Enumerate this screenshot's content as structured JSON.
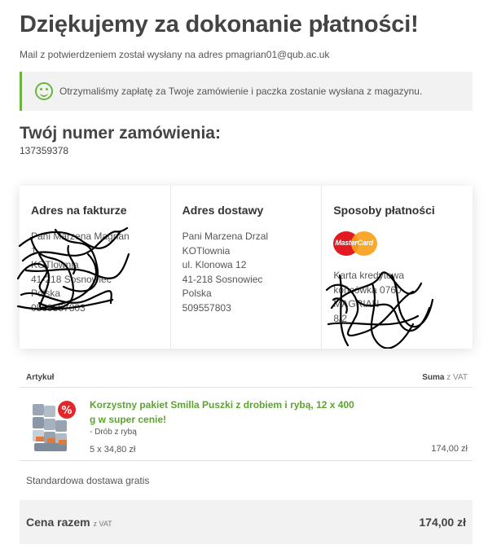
{
  "header": {
    "title": "Dziękujemy za dokonanie płatności!",
    "subtitle": "Mail z potwierdzeniem został wysłany na adres pmagrian01@qub.ac.uk"
  },
  "notice": {
    "text": "Otrzymaliśmy zapłatę za Twoje zamówienie i paczka zostanie wysłana z magazynu.",
    "icon": "smiley-icon",
    "accent_color": "#6cb33f"
  },
  "order": {
    "label": "Twój numer zamówienia:",
    "number": "137359378"
  },
  "billing": {
    "title": "Adres na fakturze",
    "lines": [
      "Pani Marzena Magrian",
      "1",
      "KOTlownia",
      "41-218 Sosnowiec",
      "Polska",
      "0509557803"
    ]
  },
  "delivery": {
    "title": "Adres dostawy",
    "lines": [
      "Pani Marzena Drzal",
      "KOTlownia",
      "ul. Klonowa 12",
      "41-218 Sosnowiec",
      "Polska",
      "509557803"
    ]
  },
  "payment": {
    "title": "Sposoby płatności",
    "logo_text": "MasterCard",
    "lines": [
      "Karta kredytowa",
      "końcówka 0760",
      "MAGRIAN",
      "8/2"
    ]
  },
  "table": {
    "col_item": "Artykuł",
    "col_sum": "Suma",
    "col_sum_suffix": "z VAT"
  },
  "product": {
    "name": "Korzystny pakiet Smilla Puszki z drobiem i rybą, 12 x 400 g w super cenie!",
    "variant": "- Drób z rybą",
    "quantity": "5 x 34,80 zł",
    "sum": "174,00 zł",
    "badge": "%"
  },
  "shipping": {
    "text": "Standardowa dostawa gratis"
  },
  "total": {
    "label": "Cena razem",
    "suffix": "z VAT",
    "value": "174,00 zł"
  }
}
